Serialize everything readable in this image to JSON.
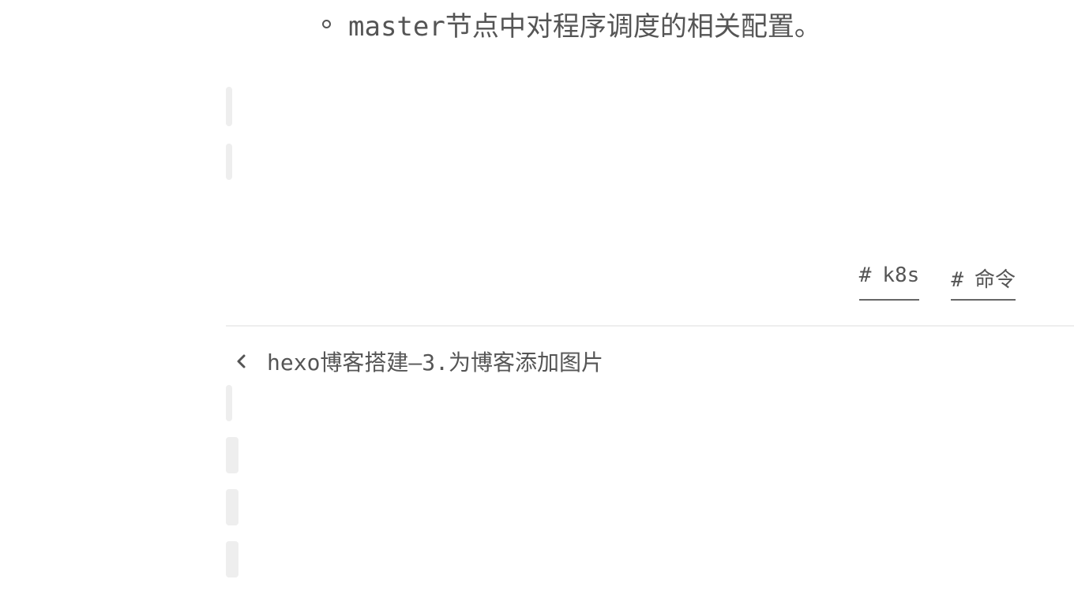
{
  "content": {
    "list_item_text": "master节点中对程序调度的相关配置。"
  },
  "tags": [
    {
      "hash": "#",
      "label": "k8s"
    },
    {
      "hash": "#",
      "label": "命令"
    }
  ],
  "post_nav": {
    "prev_title": "hexo博客搭建—3.为博客添加图片",
    "prev_icon": "chevron-left-icon"
  }
}
